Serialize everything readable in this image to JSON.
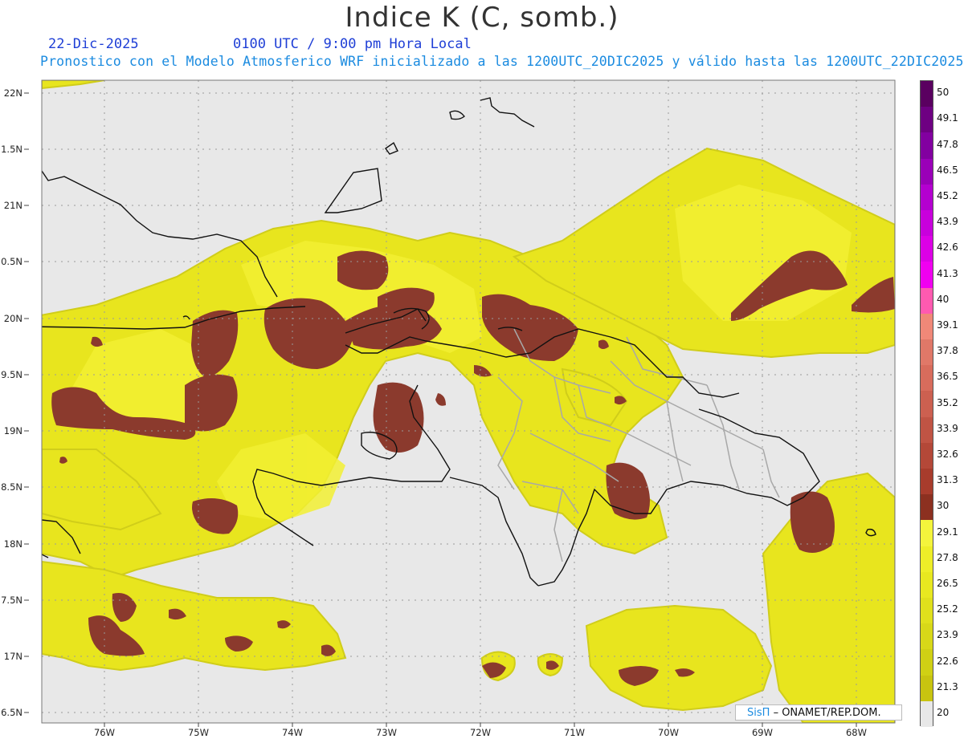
{
  "header": {
    "title": "Indice K (C, somb.)",
    "date": "22-Dic-2025",
    "time": "0100 UTC / 9:00 pm Hora Local",
    "description": "Pronostico con el Modelo Atmosferico WRF inicializado a las 1200UTC_20DIC2025 y válido hasta las  1200UTC_22DIC2025"
  },
  "map": {
    "lon_range": [
      -76.65,
      -67.45
    ],
    "lat_range": [
      16.4,
      22.1
    ],
    "lon_ticks": [
      "76W",
      "75W",
      "74W",
      "73W",
      "72W",
      "71W",
      "70W",
      "69W",
      "68W"
    ],
    "lat_ticks": [
      "22N",
      "1.5N",
      "21N",
      "0.5N",
      "20N",
      "9.5N",
      "19N",
      "8.5N",
      "18N",
      "7.5N",
      "17N",
      "6.5N"
    ],
    "grid": true,
    "colors": {
      "background": "#e8e8e8",
      "k_20_25": "#d2cf1c",
      "k_25_30": "#ebea1a",
      "k_30_plus": "#8b3a2d",
      "coastline": "#000000",
      "borders": "#a0a0a0"
    }
  },
  "legend": {
    "levels": [
      "50",
      "49.1",
      "47.8",
      "46.5",
      "45.2",
      "43.9",
      "42.6",
      "41.3",
      "40",
      "39.1",
      "37.8",
      "36.5",
      "35.2",
      "33.9",
      "32.6",
      "31.3",
      "30",
      "29.1",
      "27.8",
      "26.5",
      "25.2",
      "23.9",
      "22.6",
      "21.3",
      "20"
    ],
    "colors": [
      "#5a0060",
      "#6e0082",
      "#8200a0",
      "#9a00b8",
      "#b400d0",
      "#c800dc",
      "#dc00e6",
      "#f000f0",
      "#ff5ab0",
      "#f08878",
      "#e07868",
      "#d86c5c",
      "#cc6050",
      "#c05444",
      "#b44838",
      "#a83c2c",
      "#8c3020",
      "#f4f43c",
      "#eeee28",
      "#e8e820",
      "#e0e01c",
      "#d8d818",
      "#d0d014",
      "#c8c410",
      "#e8e8e8"
    ]
  },
  "credit": {
    "brand": "SisΠ",
    "text": "– ONAMET/REP.DOM."
  }
}
